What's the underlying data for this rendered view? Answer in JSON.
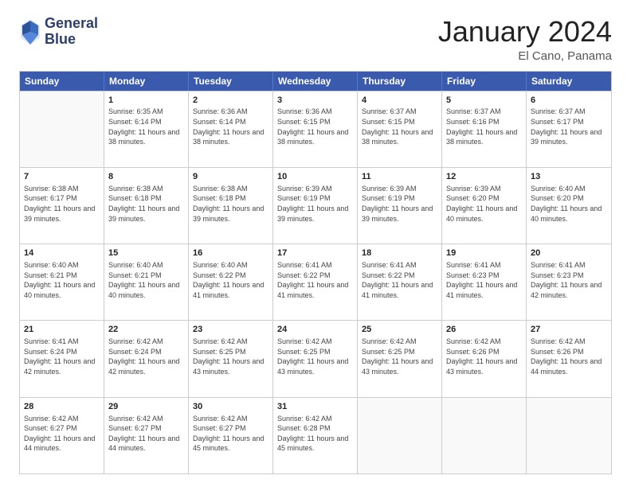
{
  "logo": {
    "line1": "General",
    "line2": "Blue"
  },
  "title": "January 2024",
  "location": "El Cano, Panama",
  "days_header": [
    "Sunday",
    "Monday",
    "Tuesday",
    "Wednesday",
    "Thursday",
    "Friday",
    "Saturday"
  ],
  "weeks": [
    [
      {
        "day": "",
        "empty": true
      },
      {
        "day": "1",
        "sunrise": "6:35 AM",
        "sunset": "6:14 PM",
        "daylight": "11 hours and 38 minutes."
      },
      {
        "day": "2",
        "sunrise": "6:36 AM",
        "sunset": "6:14 PM",
        "daylight": "11 hours and 38 minutes."
      },
      {
        "day": "3",
        "sunrise": "6:36 AM",
        "sunset": "6:15 PM",
        "daylight": "11 hours and 38 minutes."
      },
      {
        "day": "4",
        "sunrise": "6:37 AM",
        "sunset": "6:15 PM",
        "daylight": "11 hours and 38 minutes."
      },
      {
        "day": "5",
        "sunrise": "6:37 AM",
        "sunset": "6:16 PM",
        "daylight": "11 hours and 38 minutes."
      },
      {
        "day": "6",
        "sunrise": "6:37 AM",
        "sunset": "6:17 PM",
        "daylight": "11 hours and 39 minutes."
      }
    ],
    [
      {
        "day": "7",
        "sunrise": "6:38 AM",
        "sunset": "6:17 PM",
        "daylight": "11 hours and 39 minutes."
      },
      {
        "day": "8",
        "sunrise": "6:38 AM",
        "sunset": "6:18 PM",
        "daylight": "11 hours and 39 minutes."
      },
      {
        "day": "9",
        "sunrise": "6:38 AM",
        "sunset": "6:18 PM",
        "daylight": "11 hours and 39 minutes."
      },
      {
        "day": "10",
        "sunrise": "6:39 AM",
        "sunset": "6:19 PM",
        "daylight": "11 hours and 39 minutes."
      },
      {
        "day": "11",
        "sunrise": "6:39 AM",
        "sunset": "6:19 PM",
        "daylight": "11 hours and 39 minutes."
      },
      {
        "day": "12",
        "sunrise": "6:39 AM",
        "sunset": "6:20 PM",
        "daylight": "11 hours and 40 minutes."
      },
      {
        "day": "13",
        "sunrise": "6:40 AM",
        "sunset": "6:20 PM",
        "daylight": "11 hours and 40 minutes."
      }
    ],
    [
      {
        "day": "14",
        "sunrise": "6:40 AM",
        "sunset": "6:21 PM",
        "daylight": "11 hours and 40 minutes."
      },
      {
        "day": "15",
        "sunrise": "6:40 AM",
        "sunset": "6:21 PM",
        "daylight": "11 hours and 40 minutes."
      },
      {
        "day": "16",
        "sunrise": "6:40 AM",
        "sunset": "6:22 PM",
        "daylight": "11 hours and 41 minutes."
      },
      {
        "day": "17",
        "sunrise": "6:41 AM",
        "sunset": "6:22 PM",
        "daylight": "11 hours and 41 minutes."
      },
      {
        "day": "18",
        "sunrise": "6:41 AM",
        "sunset": "6:22 PM",
        "daylight": "11 hours and 41 minutes."
      },
      {
        "day": "19",
        "sunrise": "6:41 AM",
        "sunset": "6:23 PM",
        "daylight": "11 hours and 41 minutes."
      },
      {
        "day": "20",
        "sunrise": "6:41 AM",
        "sunset": "6:23 PM",
        "daylight": "11 hours and 42 minutes."
      }
    ],
    [
      {
        "day": "21",
        "sunrise": "6:41 AM",
        "sunset": "6:24 PM",
        "daylight": "11 hours and 42 minutes."
      },
      {
        "day": "22",
        "sunrise": "6:42 AM",
        "sunset": "6:24 PM",
        "daylight": "11 hours and 42 minutes."
      },
      {
        "day": "23",
        "sunrise": "6:42 AM",
        "sunset": "6:25 PM",
        "daylight": "11 hours and 43 minutes."
      },
      {
        "day": "24",
        "sunrise": "6:42 AM",
        "sunset": "6:25 PM",
        "daylight": "11 hours and 43 minutes."
      },
      {
        "day": "25",
        "sunrise": "6:42 AM",
        "sunset": "6:25 PM",
        "daylight": "11 hours and 43 minutes."
      },
      {
        "day": "26",
        "sunrise": "6:42 AM",
        "sunset": "6:26 PM",
        "daylight": "11 hours and 43 minutes."
      },
      {
        "day": "27",
        "sunrise": "6:42 AM",
        "sunset": "6:26 PM",
        "daylight": "11 hours and 44 minutes."
      }
    ],
    [
      {
        "day": "28",
        "sunrise": "6:42 AM",
        "sunset": "6:27 PM",
        "daylight": "11 hours and 44 minutes."
      },
      {
        "day": "29",
        "sunrise": "6:42 AM",
        "sunset": "6:27 PM",
        "daylight": "11 hours and 44 minutes."
      },
      {
        "day": "30",
        "sunrise": "6:42 AM",
        "sunset": "6:27 PM",
        "daylight": "11 hours and 45 minutes."
      },
      {
        "day": "31",
        "sunrise": "6:42 AM",
        "sunset": "6:28 PM",
        "daylight": "11 hours and 45 minutes."
      },
      {
        "day": "",
        "empty": true
      },
      {
        "day": "",
        "empty": true
      },
      {
        "day": "",
        "empty": true
      }
    ]
  ]
}
